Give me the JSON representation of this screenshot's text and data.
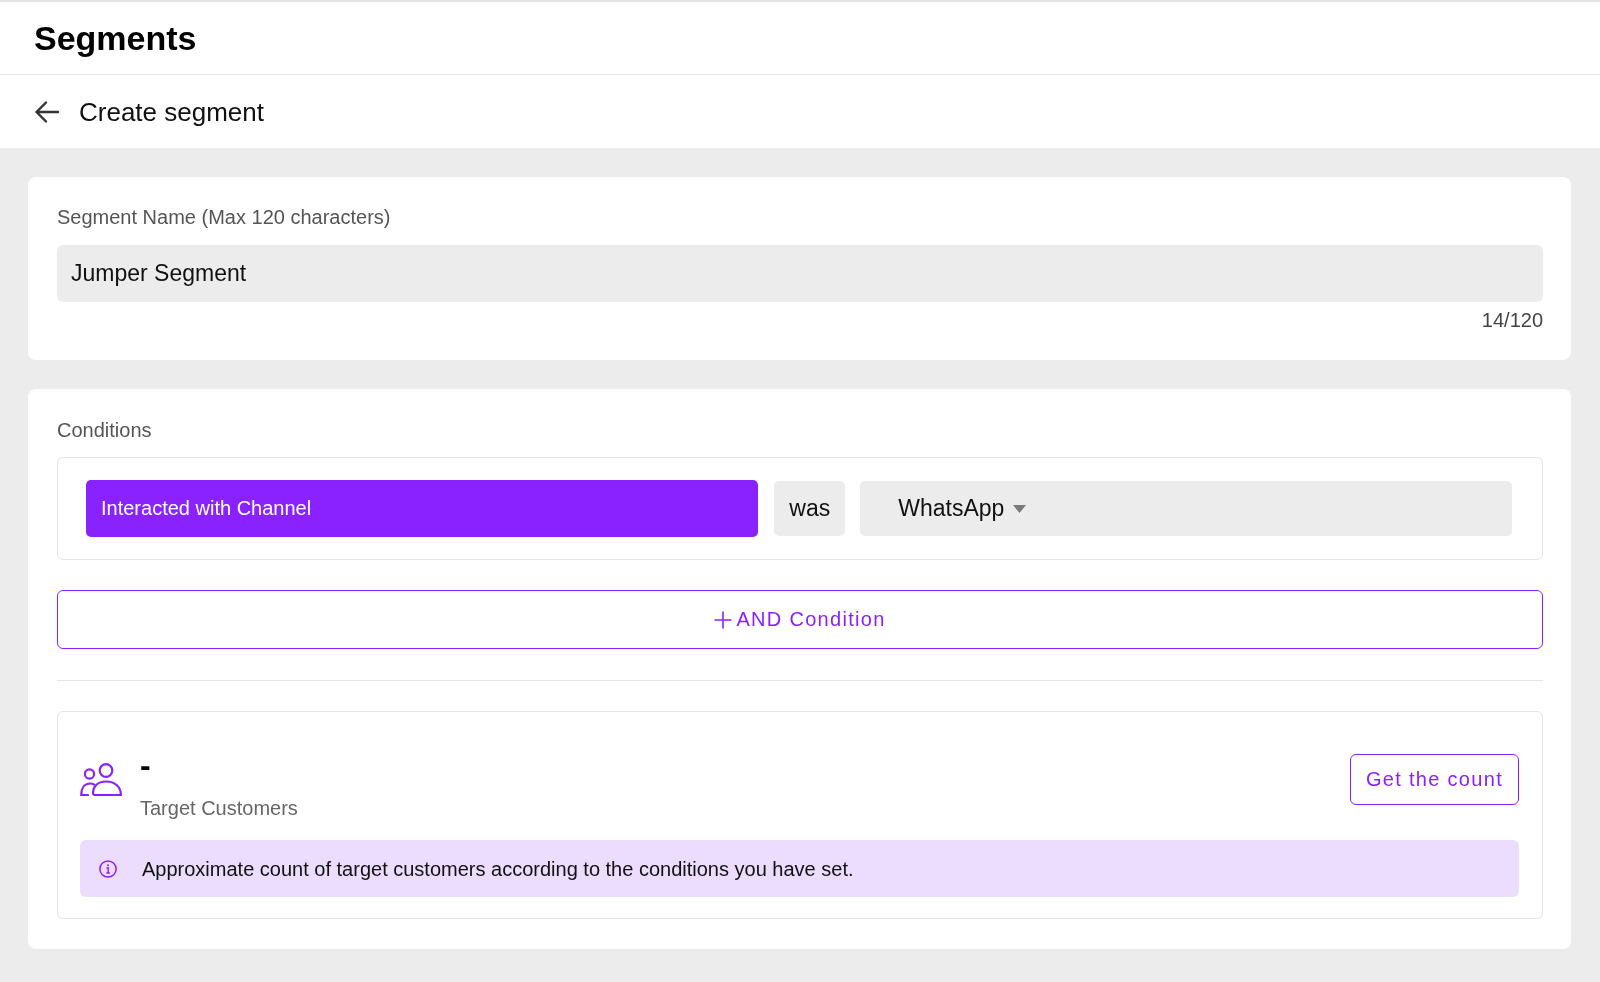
{
  "header": {
    "title": "Segments"
  },
  "subheader": {
    "title": "Create segment"
  },
  "segment_name": {
    "label": "Segment Name (Max 120 characters)",
    "value": "Jumper Segment",
    "counter": "14/120"
  },
  "conditions": {
    "label": "Conditions",
    "rows": [
      {
        "attribute": "Interacted with Channel",
        "operator": "was",
        "value": "WhatsApp"
      }
    ],
    "add_button": "AND Condition"
  },
  "target": {
    "count": "-",
    "label": "Target Customers",
    "button": "Get the count",
    "note": "Approximate count of target customers according to the conditions you have set."
  }
}
